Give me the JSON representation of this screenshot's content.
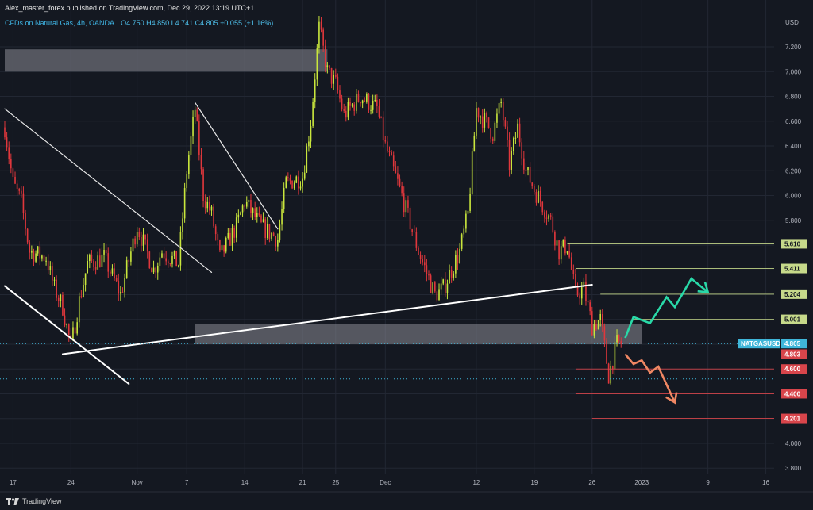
{
  "header": {
    "publish_line": "Alex_master_forex published on TradingView.com, Dec 29, 2022 13:19 UTC+1",
    "symbol_line": "CFDs on Natural Gas, 4h, OANDA",
    "ohlc": "O4.750 H4.850 L4.741 C4.805 +0.055 (+1.16%)"
  },
  "footer": {
    "brand": "TradingView"
  },
  "chart_data": {
    "type": "candlestick",
    "symbol": "NATGASUSD",
    "timeframe": "4h",
    "currency": "USD",
    "ylim": [
      3.75,
      7.45
    ],
    "y_ticks": [
      "7.200",
      "7.000",
      "6.800",
      "6.600",
      "6.400",
      "6.200",
      "6.000",
      "5.800",
      "5.600",
      "5.400",
      "5.200",
      "5.000",
      "4.800",
      "4.600",
      "4.400",
      "4.200",
      "4.000",
      "3.800"
    ],
    "x_range": [
      "2022-10-16",
      "2023-01-17"
    ],
    "x_ticks": [
      {
        "label": "17",
        "date": "2022-10-17"
      },
      {
        "label": "24",
        "date": "2022-10-24"
      },
      {
        "label": "Nov",
        "date": "2022-11-01"
      },
      {
        "label": "7",
        "date": "2022-11-07"
      },
      {
        "label": "14",
        "date": "2022-11-14"
      },
      {
        "label": "21",
        "date": "2022-11-21"
      },
      {
        "label": "25",
        "date": "2022-11-25"
      },
      {
        "label": "Dec",
        "date": "2022-12-01"
      },
      {
        "label": "12",
        "date": "2022-12-12"
      },
      {
        "label": "19",
        "date": "2022-12-19"
      },
      {
        "label": "26",
        "date": "2022-12-26"
      },
      {
        "label": "2023",
        "date": "2023-01-01"
      },
      {
        "label": "9",
        "date": "2023-01-09"
      },
      {
        "label": "16",
        "date": "2023-01-16"
      }
    ],
    "price_path": [
      [
        "2022-10-16",
        6.55
      ],
      [
        "2022-10-17",
        6.1
      ],
      [
        "2022-10-18",
        5.95
      ],
      [
        "2022-10-19",
        5.55
      ],
      [
        "2022-10-21",
        5.5
      ],
      [
        "2022-10-22",
        5.25
      ],
      [
        "2022-10-23",
        5.1
      ],
      [
        "2022-10-24",
        4.78
      ],
      [
        "2022-10-25",
        5.15
      ],
      [
        "2022-10-26",
        5.45
      ],
      [
        "2022-10-28",
        5.5
      ],
      [
        "2022-10-30",
        5.2
      ],
      [
        "2022-11-01",
        5.75
      ],
      [
        "2022-11-03",
        5.4
      ],
      [
        "2022-11-04",
        5.55
      ],
      [
        "2022-11-06",
        5.45
      ],
      [
        "2022-11-07",
        6.2
      ],
      [
        "2022-11-08",
        6.7
      ],
      [
        "2022-11-09",
        6.0
      ],
      [
        "2022-11-10",
        5.85
      ],
      [
        "2022-11-11",
        5.5
      ],
      [
        "2022-11-13",
        5.75
      ],
      [
        "2022-11-14",
        5.95
      ],
      [
        "2022-11-15",
        5.85
      ],
      [
        "2022-11-16",
        5.75
      ],
      [
        "2022-11-18",
        5.65
      ],
      [
        "2022-11-19",
        6.1
      ],
      [
        "2022-11-21",
        6.15
      ],
      [
        "2022-11-22",
        6.6
      ],
      [
        "2022-11-23",
        7.35
      ],
      [
        "2022-11-24",
        7.0
      ],
      [
        "2022-11-25",
        6.9
      ],
      [
        "2022-11-26",
        6.65
      ],
      [
        "2022-11-28",
        6.8
      ],
      [
        "2022-11-30",
        6.7
      ],
      [
        "2022-12-01",
        6.4
      ],
      [
        "2022-12-03",
        6.0
      ],
      [
        "2022-12-05",
        5.55
      ],
      [
        "2022-12-07",
        5.2
      ],
      [
        "2022-12-08",
        5.25
      ],
      [
        "2022-12-10",
        5.55
      ],
      [
        "2022-12-11",
        5.85
      ],
      [
        "2022-12-12",
        6.7
      ],
      [
        "2022-12-14",
        6.5
      ],
      [
        "2022-12-15",
        6.75
      ],
      [
        "2022-12-16",
        6.25
      ],
      [
        "2022-12-17",
        6.55
      ],
      [
        "2022-12-18",
        6.2
      ],
      [
        "2022-12-19",
        6.05
      ],
      [
        "2022-12-21",
        5.8
      ],
      [
        "2022-12-22",
        5.55
      ],
      [
        "2022-12-23",
        5.6
      ],
      [
        "2022-12-24",
        5.2
      ],
      [
        "2022-12-25",
        5.25
      ],
      [
        "2022-12-26",
        4.95
      ],
      [
        "2022-12-27",
        5.0
      ],
      [
        "2022-12-28",
        4.55
      ],
      [
        "2022-12-29",
        4.805
      ]
    ],
    "candles_note": "",
    "zones": [
      {
        "from": "2022-10-16",
        "to": "2022-11-24",
        "low": 7.0,
        "high": 7.18
      },
      {
        "from": "2022-11-08",
        "to": "2023-01-01",
        "low": 4.8,
        "high": 4.96
      }
    ],
    "trendlines": [
      {
        "color": "#e8e8e8",
        "width": 1.2,
        "points": [
          [
            "2022-10-16",
            6.7
          ],
          [
            "2022-11-10",
            5.38
          ]
        ]
      },
      {
        "color": "#e8e8e8",
        "width": 1.2,
        "points": [
          [
            "2022-11-08",
            6.75
          ],
          [
            "2022-11-18",
            5.73
          ]
        ]
      },
      {
        "color": "#ffffff",
        "width": 2,
        "points": [
          [
            "2022-10-16",
            5.27
          ],
          [
            "2022-10-31",
            4.48
          ]
        ]
      },
      {
        "color": "#ffffff",
        "width": 2,
        "points": [
          [
            "2022-10-23",
            4.72
          ],
          [
            "2022-12-26",
            5.28
          ]
        ]
      }
    ],
    "levels": [
      {
        "price": 5.61,
        "label": "5.610",
        "color": "#c6d98a",
        "from": "2022-12-23"
      },
      {
        "price": 5.411,
        "label": "5.411",
        "color": "#c6d98a",
        "from": "2022-12-24"
      },
      {
        "price": 5.204,
        "label": "5.204",
        "color": "#c6d98a",
        "from": "2022-12-27"
      },
      {
        "price": 5.001,
        "label": "5.001",
        "color": "#c6d98a",
        "from": "2022-12-31"
      },
      {
        "price": 4.6,
        "label": "4.600",
        "color": "#d8454b",
        "from": "2022-12-24"
      },
      {
        "price": 4.4,
        "label": "4.400",
        "color": "#d8454b",
        "from": "2022-12-24"
      },
      {
        "price": 4.201,
        "label": "4.201",
        "color": "#d8454b",
        "from": "2022-12-26"
      }
    ],
    "dotted_levels": [
      {
        "price": 4.805,
        "color": "#3fb6d9"
      },
      {
        "price": 4.52,
        "color": "#3fb6d9"
      }
    ],
    "price_tags": [
      {
        "price": 4.805,
        "text": "4.805",
        "name": "NATGASUSD",
        "color": "#3fb6d9"
      },
      {
        "price": 4.72,
        "text": "4.803",
        "color": "#d8454b"
      }
    ],
    "arrows": [
      {
        "color": "#29d9a8",
        "points": [
          [
            "2022-12-30",
            4.85
          ],
          [
            "2022-12-31",
            5.02
          ],
          [
            "2023-01-02",
            4.97
          ],
          [
            "2023-01-04",
            5.18
          ],
          [
            "2023-01-05",
            5.1
          ],
          [
            "2023-01-07",
            5.33
          ],
          [
            "2023-01-09",
            5.22
          ]
        ]
      },
      {
        "color": "#f08763",
        "points": [
          [
            "2022-12-30",
            4.72
          ],
          [
            "2022-12-31",
            4.64
          ],
          [
            "2023-01-01",
            4.67
          ],
          [
            "2023-01-02",
            4.57
          ],
          [
            "2023-01-03",
            4.62
          ],
          [
            "2023-01-05",
            4.33
          ]
        ]
      }
    ]
  }
}
